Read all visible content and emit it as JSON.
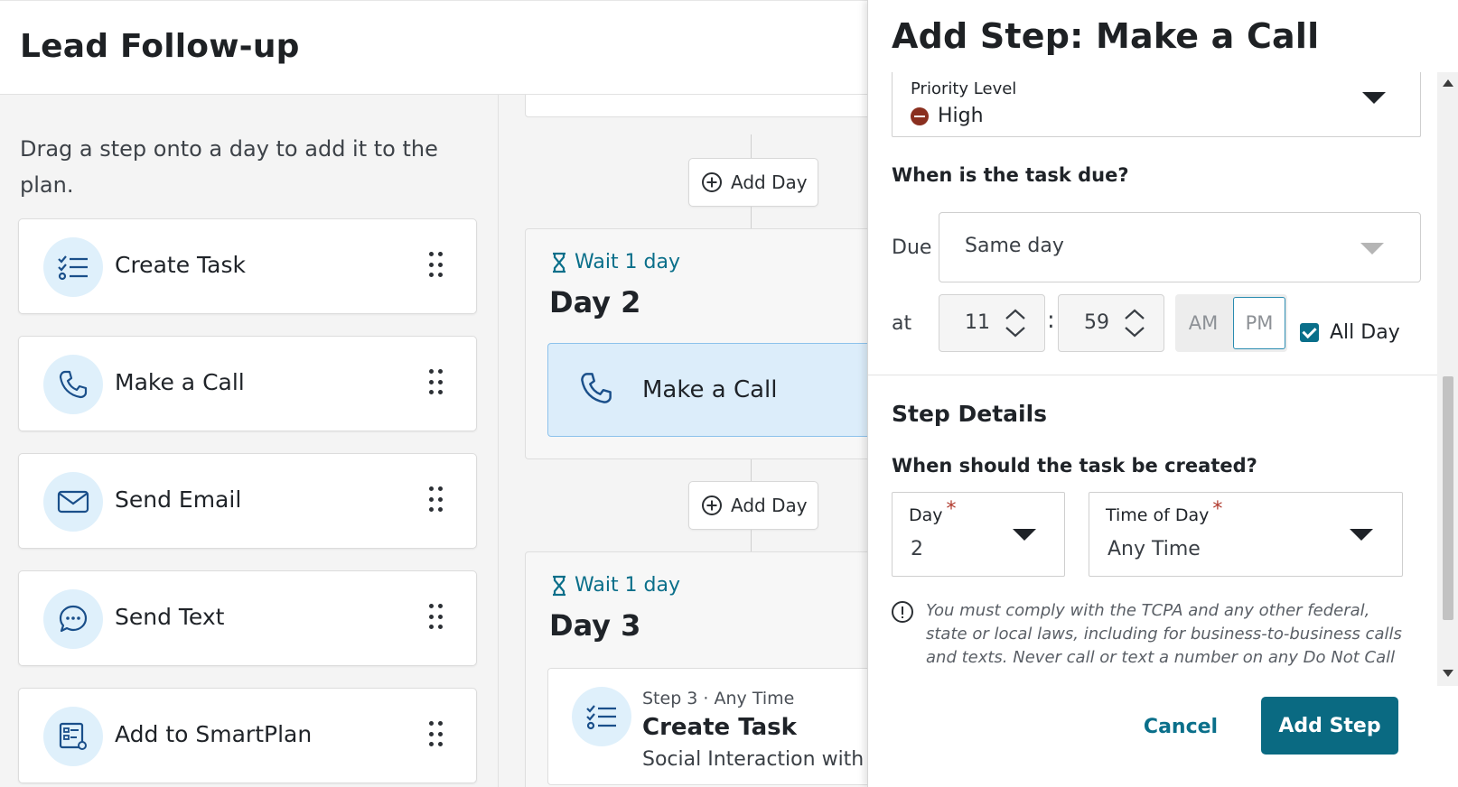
{
  "header": {
    "title": "Lead Follow-up"
  },
  "palette": {
    "hint": "Drag a step onto a day to add it to the plan.",
    "steps": [
      {
        "label": "Create Task",
        "icon": "task-list-icon"
      },
      {
        "label": "Make a Call",
        "icon": "phone-icon"
      },
      {
        "label": "Send Email",
        "icon": "envelope-icon"
      },
      {
        "label": "Send Text",
        "icon": "chat-bubble-icon"
      },
      {
        "label": "Add to SmartPlan",
        "icon": "smartplan-icon"
      }
    ]
  },
  "timeline": {
    "add_day_label": "Add Day",
    "days": [
      {
        "wait": "Wait 1 day",
        "title": "Day 2",
        "card": {
          "label": "Make a Call"
        }
      },
      {
        "wait": "Wait 1 day",
        "title": "Day 3",
        "card": {
          "meta": "Step 3 · Any Time",
          "title": "Create Task",
          "subtitle": "Social Interaction with"
        }
      }
    ]
  },
  "drawer": {
    "title": "Add Step: Make a Call",
    "priority": {
      "label": "Priority Level",
      "value": "High",
      "color": "#8a2f1f"
    },
    "due_question": "When is the task due?",
    "due_label": "Due",
    "due_value": "Same day",
    "at_label": "at",
    "hour": "11",
    "minute": "59",
    "am": "AM",
    "pm": "PM",
    "all_day": {
      "label": "All Day",
      "checked": true
    },
    "details_title": "Step Details",
    "created_question": "When should the task be created?",
    "day_field": {
      "label": "Day",
      "value": "2"
    },
    "time_field": {
      "label": "Time of Day",
      "value": "Any Time"
    },
    "notice": "You must comply with the TCPA and any other federal, state or local laws, including for business-to-business calls and texts. Never call or text a number on any Do Not Call list, and do not use pre-recorded, artificial voice or automated",
    "cancel_label": "Cancel",
    "add_label": "Add Step"
  },
  "colors": {
    "accent": "#0a6f8a",
    "primary_button": "#0a6a82",
    "selected_card": "#dcedfa",
    "required": "#b03a2e"
  }
}
